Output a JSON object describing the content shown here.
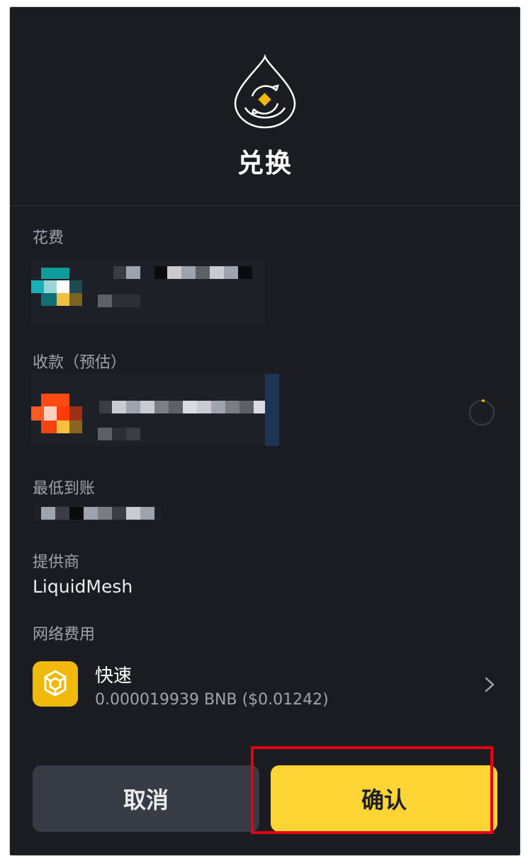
{
  "header": {
    "title": "兑换",
    "icon": "swap-drop-icon"
  },
  "sections": {
    "spend_label": "花费",
    "receive_label": "收款（预估）",
    "min_received_label": "最低到账",
    "provider_label": "提供商",
    "provider_value": "LiquidMesh",
    "network_fee_label": "网络费用"
  },
  "network_fee": {
    "speed": "快速",
    "cost": "0.000019939 BNB ($0.01242)",
    "icon": "bnb-icon"
  },
  "buttons": {
    "cancel": "取消",
    "confirm": "确认"
  },
  "colors": {
    "background": "#1b1c21",
    "accent_yellow": "#fcd535",
    "bnb_yellow": "#f0b90b",
    "highlight_red": "#e60012"
  }
}
